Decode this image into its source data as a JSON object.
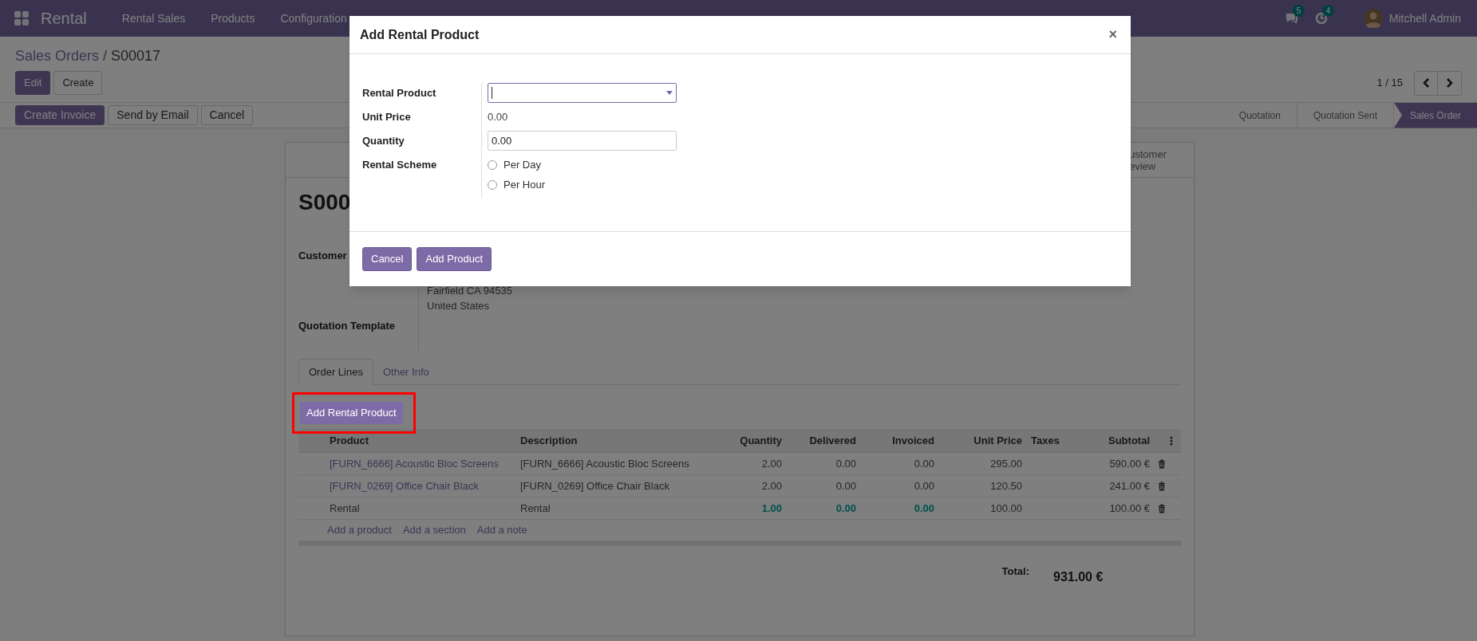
{
  "navbar": {
    "app_name": "Rental",
    "menu": [
      "Rental Sales",
      "Products",
      "Configuration"
    ],
    "messages_count": "5",
    "activities_count": "4",
    "user": "Mitchell Admin"
  },
  "breadcrumb": {
    "parent": "Sales Orders",
    "separator": "/",
    "current": "S00017"
  },
  "control_buttons": [
    "Edit",
    "Create"
  ],
  "pager": {
    "text": "1 / 15"
  },
  "action_buttons": [
    {
      "label": "Create Invoice",
      "primary": true
    },
    {
      "label": "Send by Email",
      "primary": false
    },
    {
      "label": "Cancel",
      "primary": false
    }
  ],
  "status_steps": [
    {
      "label": "Quotation",
      "selected": false
    },
    {
      "label": "Quotation Sent",
      "selected": false
    },
    {
      "label": "Sales Order",
      "selected": true
    }
  ],
  "sheet": {
    "smart_button": [
      "ustomer",
      "eview"
    ],
    "title": "S000",
    "customer_label": "Customer",
    "address": [
      "Fairfield CA 94535",
      "United States"
    ],
    "template_label": "Quotation Template",
    "tabs": [
      {
        "label": "Order Lines",
        "selected": true
      },
      {
        "label": "Other Info",
        "selected": false
      }
    ],
    "add_rental_button": "Add Rental Product",
    "table": {
      "columns": [
        "Product",
        "Description",
        "Quantity",
        "Delivered",
        "Invoiced",
        "Unit Price",
        "Taxes",
        "Subtotal"
      ],
      "rows": [
        {
          "kind": "product",
          "cells": [
            "[FURN_6666] Acoustic Bloc Screens",
            "[FURN_6666] Acoustic Bloc Screens",
            "2.00",
            "0.00",
            "0.00",
            "295.00",
            "",
            "590.00 €"
          ]
        },
        {
          "kind": "product",
          "cells": [
            "[FURN_0269] Office Chair Black",
            "[FURN_0269] Office Chair Black",
            "2.00",
            "0.00",
            "0.00",
            "120.50",
            "",
            "241.00 €"
          ]
        },
        {
          "kind": "rental",
          "cells": [
            "Rental",
            "Rental",
            "1.00",
            "0.00",
            "0.00",
            "100.00",
            "",
            "100.00 €"
          ]
        }
      ]
    },
    "add_links": [
      "Add a product",
      "Add a section",
      "Add a note"
    ],
    "total_label": "Total:",
    "total": "931.00 €"
  },
  "dialog": {
    "title": "Add Rental Product",
    "close": "×",
    "fields": [
      {
        "kind": "select",
        "label": "Rental Product"
      },
      {
        "kind": "text",
        "label": "Unit Price",
        "value": "0.00"
      },
      {
        "kind": "input",
        "label": "Quantity",
        "value": "0.00"
      },
      {
        "kind": "radio",
        "label": "Rental Scheme",
        "options": [
          {
            "label": "Per Day",
            "checked": false
          },
          {
            "label": "Per Hour",
            "checked": false
          }
        ]
      }
    ],
    "buttons": [
      "Cancel",
      "Add Product"
    ]
  }
}
